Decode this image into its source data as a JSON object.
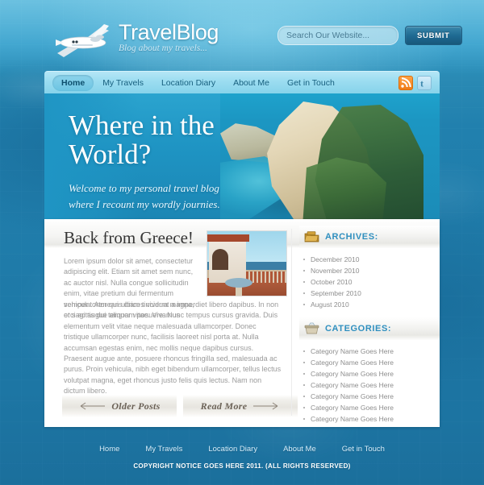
{
  "header": {
    "logo_icon": "airplane-icon",
    "brand_title": "TravelBlog",
    "brand_tagline": "Blog about my travels...",
    "search": {
      "placeholder": "Search Our Website...",
      "value": "",
      "submit_label": "SUBMIT"
    }
  },
  "nav": {
    "items": [
      {
        "label": "Home",
        "active": true
      },
      {
        "label": "My Travels",
        "active": false
      },
      {
        "label": "Location Diary",
        "active": false
      },
      {
        "label": "About Me",
        "active": false
      },
      {
        "label": "Get in Touch",
        "active": false
      }
    ],
    "social": [
      {
        "icon": "rss-icon",
        "color": "#ef7a15"
      },
      {
        "icon": "twitter-icon",
        "color": "#a9d9ef"
      }
    ]
  },
  "hero": {
    "heading_line1": "Where in the",
    "heading_line2": "World?",
    "subtitle_line1": "Welcome to my personal travel blog",
    "subtitle_line2": "where I recount my wordly journies.",
    "image_alt": "coastal-cliff-photo"
  },
  "article": {
    "title": "Back from Greece!",
    "thumbnail_alt": "terrace-sea-view-photo",
    "body_indent": "Lorem ipsum dolor sit amet, consectetur adipiscing elit. Etiam sit amet sem nunc, ac auctor nisl. Nulla congue sollicitudin enim, vitae pretium dui fermentum vehicula. Aenean ultrices viverra magna, et sagittis dui tempor vitae. Vivamus",
    "body_rest": "semper tortor quis diam tincidunt a imperdiet libero dapibus. In non orci ac augue aliquam posuere. Nunc tempus cursus gravida. Duis elementum velit vitae neque malesuada ullamcorper. Donec tristique ullamcorper nunc, facilisis laoreet nisl porta at. Nulla accumsan egestas enim, nec mollis neque dapibus cursus. Praesent augue ante, posuere rhoncus fringilla sed, malesuada ac purus. Proin vehicula, nibh eget bibendum ullamcorper, tellus lectus volutpat magna, eget rhoncus justo felis quis lectus. Nam non dictum libero.",
    "older_posts_label": "Older Posts",
    "read_more_label": "Read More"
  },
  "sidebar": {
    "archives": {
      "icon": "folder-icon",
      "title": "ARCHIVES:",
      "items": [
        "December 2010",
        "November 2010",
        "October 2010",
        "September 2010",
        "August 2010"
      ]
    },
    "categories": {
      "icon": "box-icon",
      "title": "CATEGORIES:",
      "items": [
        "Category Name Goes Here",
        "Category Name Goes Here",
        "Category Name Goes Here",
        "Category Name Goes Here",
        "Category Name Goes Here",
        "Category Name Goes Here",
        "Category Name Goes Here"
      ]
    }
  },
  "footer": {
    "links": [
      "Home",
      "My Travels",
      "Location Diary",
      "About Me",
      "Get in Touch"
    ],
    "copyright": "COPYRIGHT NOTICE GOES HERE 2011. (ALL RIGHTS RESERVED)"
  },
  "colors": {
    "page_bg": "#1d7aab",
    "nav_bg": "#9adcf0",
    "accent_blue": "#2f8fbf",
    "rss_orange": "#ef7a15"
  }
}
